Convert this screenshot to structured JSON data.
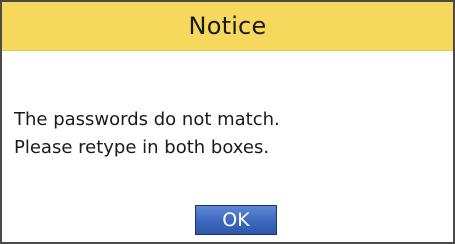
{
  "dialog": {
    "title": "Notice",
    "message_lines": [
      "The passwords do not match.",
      "Please retype in both boxes."
    ],
    "ok_label": "OK"
  },
  "colors": {
    "title_bar": "#f6d95c",
    "ok_button": "#3d68bd",
    "border": "#4a4a4a"
  }
}
